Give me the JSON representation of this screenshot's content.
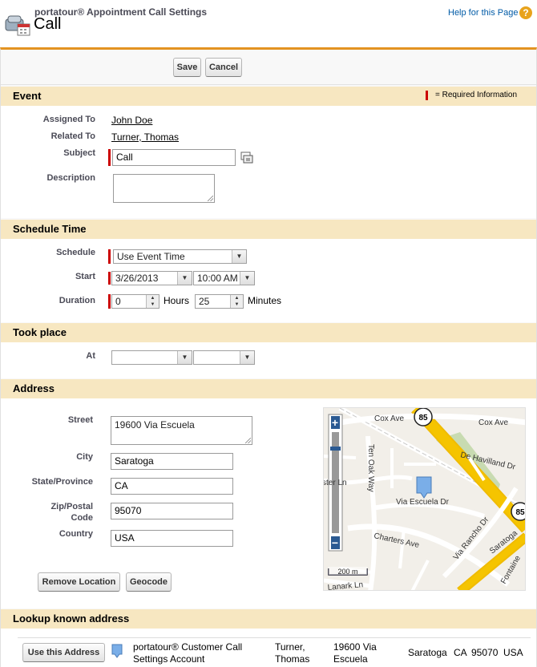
{
  "header": {
    "subtitle": "portatour® Appointment Call Settings",
    "title": "Call",
    "help_link": "Help for this Page",
    "help_icon": "?"
  },
  "toolbar": {
    "save_label": "Save",
    "cancel_label": "Cancel"
  },
  "event": {
    "section_title": "Event",
    "required_legend": "= Required Information",
    "assigned_to_label": "Assigned To",
    "assigned_to_value": "John Doe",
    "related_to_label": "Related To",
    "related_to_value": "Turner, Thomas",
    "subject_label": "Subject",
    "subject_value": "Call",
    "description_label": "Description",
    "description_value": ""
  },
  "schedule": {
    "section_title": "Schedule Time",
    "schedule_label": "Schedule",
    "schedule_value": "Use Event Time",
    "start_label": "Start",
    "start_date": "3/26/2013",
    "start_time": "10:00 AM",
    "duration_label": "Duration",
    "duration_hours": "0",
    "hours_label": "Hours",
    "duration_minutes": "25",
    "minutes_label": "Minutes"
  },
  "took_place": {
    "section_title": "Took place",
    "at_label": "At",
    "at_date": "",
    "at_time": ""
  },
  "address": {
    "section_title": "Address",
    "street_label": "Street",
    "street_value": "19600 Via Escuela",
    "city_label": "City",
    "city_value": "Saratoga",
    "state_label": "State/Province",
    "state_value": "CA",
    "zip_label_1": "Zip/Postal",
    "zip_label_2": "Code",
    "zip_value": "95070",
    "country_label": "Country",
    "country_value": "USA",
    "remove_location_label": "Remove Location",
    "geocode_label": "Geocode"
  },
  "map": {
    "streets": [
      "Cox Ave",
      "Cox Ave",
      "De Havilland Dr",
      "Ten Oak Way",
      "ster Ln",
      "Via Escuela Dr",
      "Via Rancho Dr",
      "Charters Ave",
      "Saratoga",
      "Fontaine",
      "Lanark Ln"
    ],
    "highway_shield": "85",
    "scale_label": "200 m",
    "zoom_in": "+",
    "zoom_out": "−",
    "colors": {
      "highway": "#f5c400",
      "park": "#c8dbb1",
      "ground": "#f2efe9",
      "marker": "#7aaee8"
    }
  },
  "lookup": {
    "section_title": "Lookup known address",
    "rows": [
      {
        "button_label": "Use this Address",
        "account_line1": "portatour® Customer Call",
        "account_line2": "Settings Account",
        "contact_line1": "Turner,",
        "contact_line2": "Thomas",
        "street_line1": "19600 Via",
        "street_line2": "Escuela",
        "city": "Saratoga",
        "state": "CA",
        "zip": "95070",
        "country": "USA"
      }
    ]
  },
  "colors": {
    "accent": "#e39321",
    "section_bg": "#f7e7c1",
    "required": "#cc0000",
    "link": "#015ba7"
  }
}
